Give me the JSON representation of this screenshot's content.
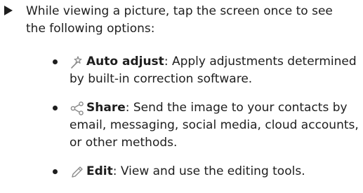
{
  "intro": {
    "text": "While viewing a picture, tap the screen once to see the following options:"
  },
  "options": [
    {
      "icon": "auto-adjust-icon",
      "title": "Auto adjust",
      "description": ": Apply adjustments determined by built-in correction software."
    },
    {
      "icon": "share-icon",
      "title": "Share",
      "description": ": Send the image to your contacts by email, messaging, social media, cloud accounts, or other methods."
    },
    {
      "icon": "edit-icon",
      "title": "Edit",
      "description": ": View and use the editing tools."
    }
  ]
}
